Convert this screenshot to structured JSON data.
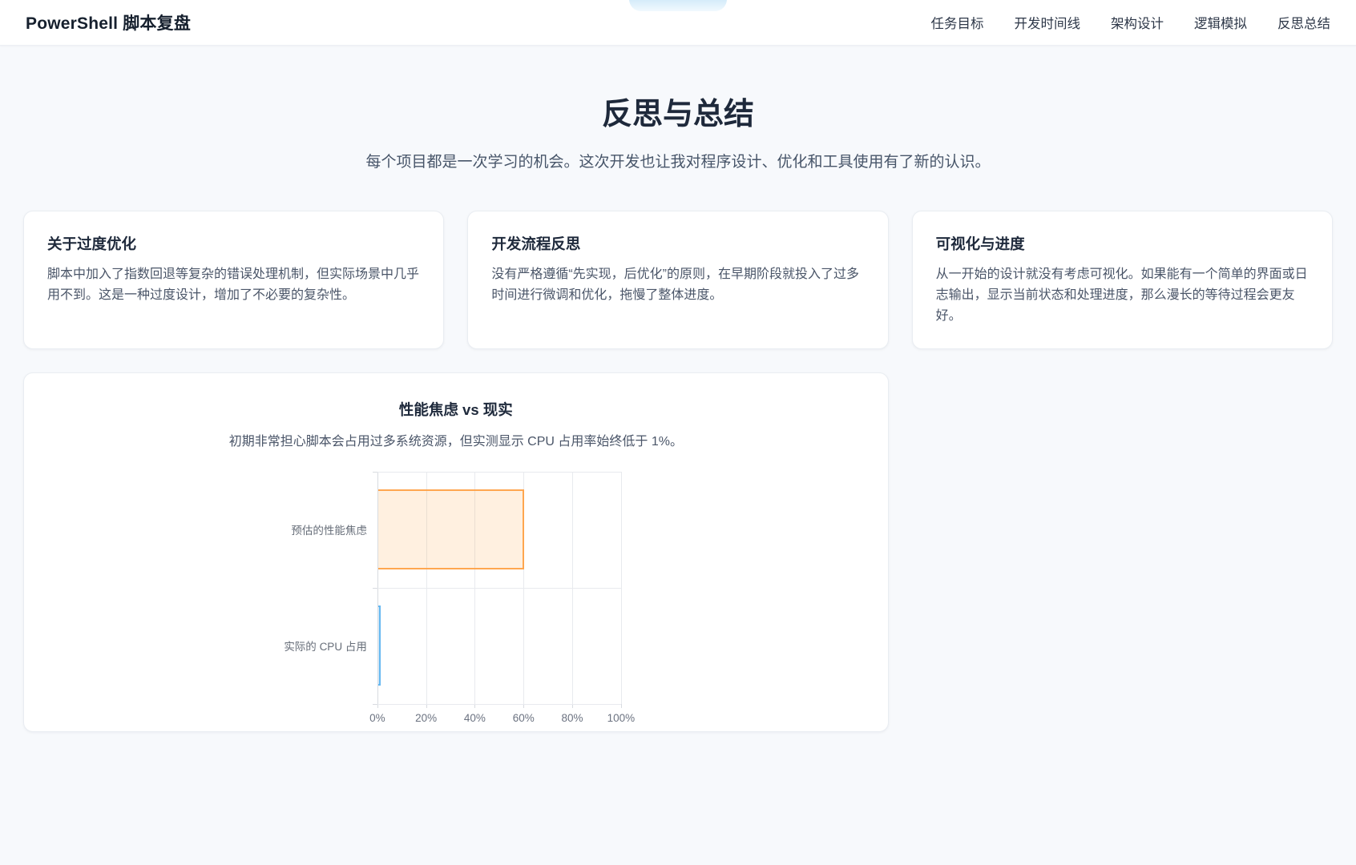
{
  "header": {
    "brand": "PowerShell 脚本复盘",
    "nav": [
      {
        "label": "任务目标"
      },
      {
        "label": "开发时间线"
      },
      {
        "label": "架构设计"
      },
      {
        "label": "逻辑模拟"
      },
      {
        "label": "反思总结"
      }
    ]
  },
  "hero": {
    "title": "反思与总结",
    "subtitle": "每个项目都是一次学习的机会。这次开发也让我对程序设计、优化和工具使用有了新的认识。"
  },
  "cards": [
    {
      "title": "关于过度优化",
      "body": "脚本中加入了指数回退等复杂的错误处理机制，但实际场景中几乎用不到。这是一种过度设计，增加了不必要的复杂性。"
    },
    {
      "title": "开发流程反思",
      "body": "没有严格遵循“先实现，后优化”的原则，在早期阶段就投入了过多时间进行微调和优化，拖慢了整体进度。"
    },
    {
      "title": "可视化与进度",
      "body": "从一开始的设计就没有考虑可视化。如果能有一个简单的界面或日志输出，显示当前状态和处理进度，那么漫长的等待过程会更友好。"
    }
  ],
  "chart_card": {
    "title": "性能焦虑 vs 现实",
    "subtitle": "初期非常担心脚本会占用过多系统资源，但实测显示 CPU 占用率始终低于 1%。"
  },
  "chart_data": {
    "type": "bar",
    "orientation": "horizontal",
    "title": "性能焦虑 vs 现实",
    "categories": [
      "预估的性能焦虑",
      "实际的 CPU 占用"
    ],
    "values": [
      60,
      1
    ],
    "xlabel": "",
    "ylabel": "",
    "xlim": [
      0,
      100
    ],
    "x_ticks": [
      "0%",
      "20%",
      "40%",
      "60%",
      "80%",
      "100%"
    ],
    "grid": true,
    "legend": false,
    "bar_styles": [
      {
        "fill": "rgba(255,159,64,0.16)",
        "border": "rgba(255,159,64,0.9)"
      },
      {
        "fill": "rgba(54,162,235,0.2)",
        "border": "rgba(54,162,235,0.7)"
      }
    ]
  },
  "colors": {
    "background": "#f7f9fc",
    "header_background": "#ffffff",
    "heading_text": "#1e293b",
    "body_text": "#4a5568",
    "grid_line": "#e8eaee",
    "tick_text": "#6b7280",
    "bar_orange": "#ff9f40",
    "bar_blue": "#36a2eb"
  }
}
